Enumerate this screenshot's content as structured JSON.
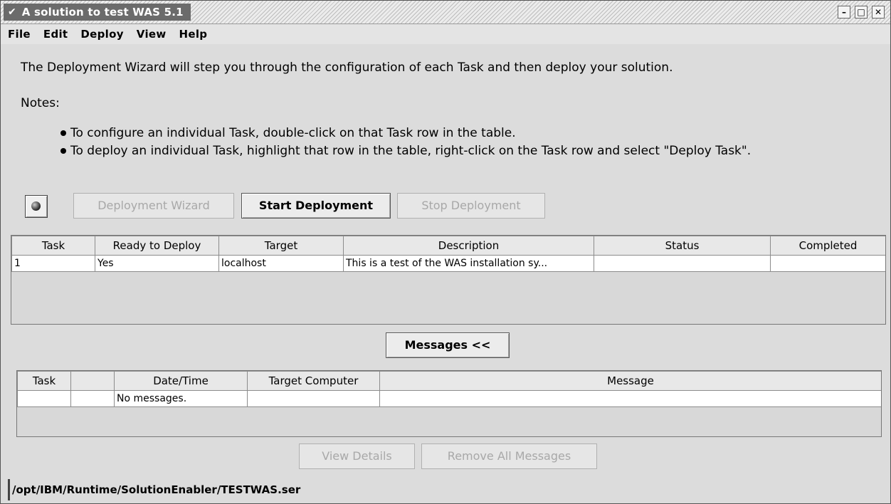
{
  "window": {
    "title": "A solution to test WAS 5.1"
  },
  "menu": [
    {
      "label": "File"
    },
    {
      "label": "Edit"
    },
    {
      "label": "Deploy"
    },
    {
      "label": "View"
    },
    {
      "label": "Help"
    }
  ],
  "intro": "The Deployment Wizard will step you through the configuration of each Task and then deploy your solution.",
  "notes": {
    "label": "Notes:",
    "items": [
      "To configure an individual Task, double-click on that Task row in the table.",
      "To deploy an individual Task, highlight that row in the table, right-click on the Task row and select \"Deploy Task\"."
    ]
  },
  "actions": {
    "wizard": "Deployment Wizard",
    "start": "Start Deployment",
    "stop": "Stop Deployment"
  },
  "task_table": {
    "headers": [
      "Task",
      "Ready to Deploy",
      "Target",
      "Description",
      "Status",
      "Completed"
    ],
    "rows": [
      [
        "1",
        "Yes",
        "localhost",
        "This is a test of the WAS installation sy...",
        "",
        ""
      ]
    ]
  },
  "messages_toggle": "Messages <<",
  "message_table": {
    "headers": [
      "Task",
      "",
      "Date/Time",
      "Target Computer",
      "Message"
    ],
    "rows": [
      [
        "",
        "",
        "No messages.",
        "",
        ""
      ]
    ]
  },
  "bottom_actions": {
    "view_details": "View Details",
    "remove_all": "Remove All Messages"
  },
  "status_path": "/opt/IBM/Runtime/SolutionEnabler/TESTWAS.ser"
}
